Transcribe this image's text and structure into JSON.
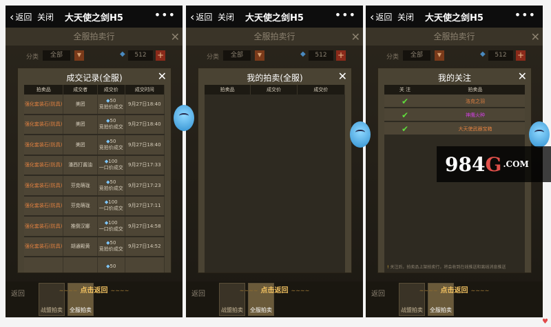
{
  "wechat": {
    "back_label": "返回",
    "close_label": "关闭",
    "title": "大天使之剑H5",
    "more_label": "•••"
  },
  "shared": {
    "header_title": "全服拍卖行",
    "filter_label": "分类",
    "filter_value": "全部",
    "currency_value": "512",
    "plus_label": "+",
    "back_banner": "点击返回",
    "return_label": "返回",
    "tab_alliance": "战盟拍卖",
    "tab_server": "全服拍卖"
  },
  "panel1": {
    "title": "成交记录(全服)",
    "columns": [
      "拍卖品",
      "成交者",
      "成交价",
      "成交时间"
    ],
    "rows": [
      {
        "item": "强化套装石(防具)",
        "buyer": "美团",
        "price": "50",
        "type": "竞拍价成交",
        "time": "9月27日18:40"
      },
      {
        "item": "强化套装石(防具)",
        "buyer": "美团",
        "price": "50",
        "type": "竞拍价成交",
        "time": "9月27日18:40"
      },
      {
        "item": "强化套装石(防具)",
        "buyer": "美团",
        "price": "50",
        "type": "竞拍价成交",
        "time": "9月27日18:40"
      },
      {
        "item": "强化套装石(防具)",
        "buyer": "潘西打酱油",
        "price": "100",
        "type": "一口价成交",
        "time": "9月27日17:33"
      },
      {
        "item": "强化套装石(防具)",
        "buyer": "芬克萌珑",
        "price": "50",
        "type": "竞拍价成交",
        "time": "9月27日17:23"
      },
      {
        "item": "强化套装石(防具)",
        "buyer": "芬克萌珑",
        "price": "100",
        "type": "一口价成交",
        "time": "9月27日17:11"
      },
      {
        "item": "强化套装石(防具)",
        "buyer": "推倒汉娜",
        "price": "100",
        "type": "一口价成交",
        "time": "9月27日14:58"
      },
      {
        "item": "强化套装石(防具)",
        "buyer": "胡通殿黄",
        "price": "50",
        "type": "竞拍价成交",
        "time": "9月27日14:52"
      }
    ],
    "partial_price": "50"
  },
  "panel2": {
    "title": "我的拍卖(全服)",
    "columns": [
      "拍卖品",
      "成交价",
      "成交价"
    ]
  },
  "panel3": {
    "title": "我的关注",
    "columns": [
      "关 注",
      "拍卖品"
    ],
    "rows": [
      {
        "check": "✔",
        "name": "洛克之羽",
        "color": "#e08040"
      },
      {
        "check": "✔",
        "name": "神鹰火种",
        "color": "#d040e0"
      },
      {
        "check": "✔",
        "name": "大天使武器宝箱",
        "color": "#e08040"
      }
    ],
    "note": "关注后，拍卖品上架拍卖行，将会收到在线推送和离线消息推送"
  },
  "watermark": {
    "main": "984",
    "accent": "G",
    "suffix": ".COM"
  },
  "colors": {
    "item_orange": "#e08040",
    "check_green": "#5fdc3c",
    "gem_blue": "#7fc8ff"
  }
}
